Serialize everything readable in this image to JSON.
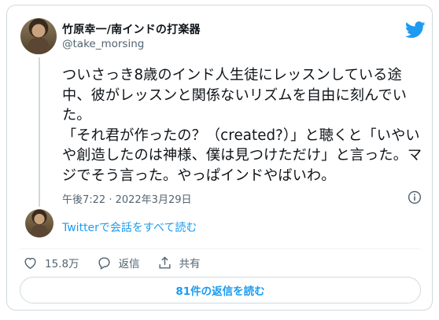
{
  "author": {
    "display_name": "竹原幸一/南インドの打楽器",
    "handle": "@take_morsing"
  },
  "tweet": {
    "text": "ついさっき8歳のインド人生徒にレッスンしている途中、彼がレッスンと関係ないリズムを自由に刻んでいた。\n「それ君が作ったの？（created?）」と聴くと「いやいや創造したのは神様、僕は見つけただけ」と言った。マジでそう言った。やっぱインドやばいわ。",
    "timestamp": "午後7:22 · 2022年3月29日"
  },
  "conversation": {
    "read_label": "Twitterで会話をすべて読む"
  },
  "actions": {
    "like_count": "15.8万",
    "reply_label": "返信",
    "share_label": "共有"
  },
  "footer": {
    "replies_button_label": "81件の返信を読む"
  },
  "colors": {
    "accent": "#1d9bf0",
    "secondary_text": "#536471",
    "border": "#cfd9de"
  },
  "icons": {
    "logo": "twitter-bird-icon",
    "info": "info-icon",
    "like": "heart-icon",
    "reply": "reply-bubble-icon",
    "share": "share-upload-icon"
  }
}
